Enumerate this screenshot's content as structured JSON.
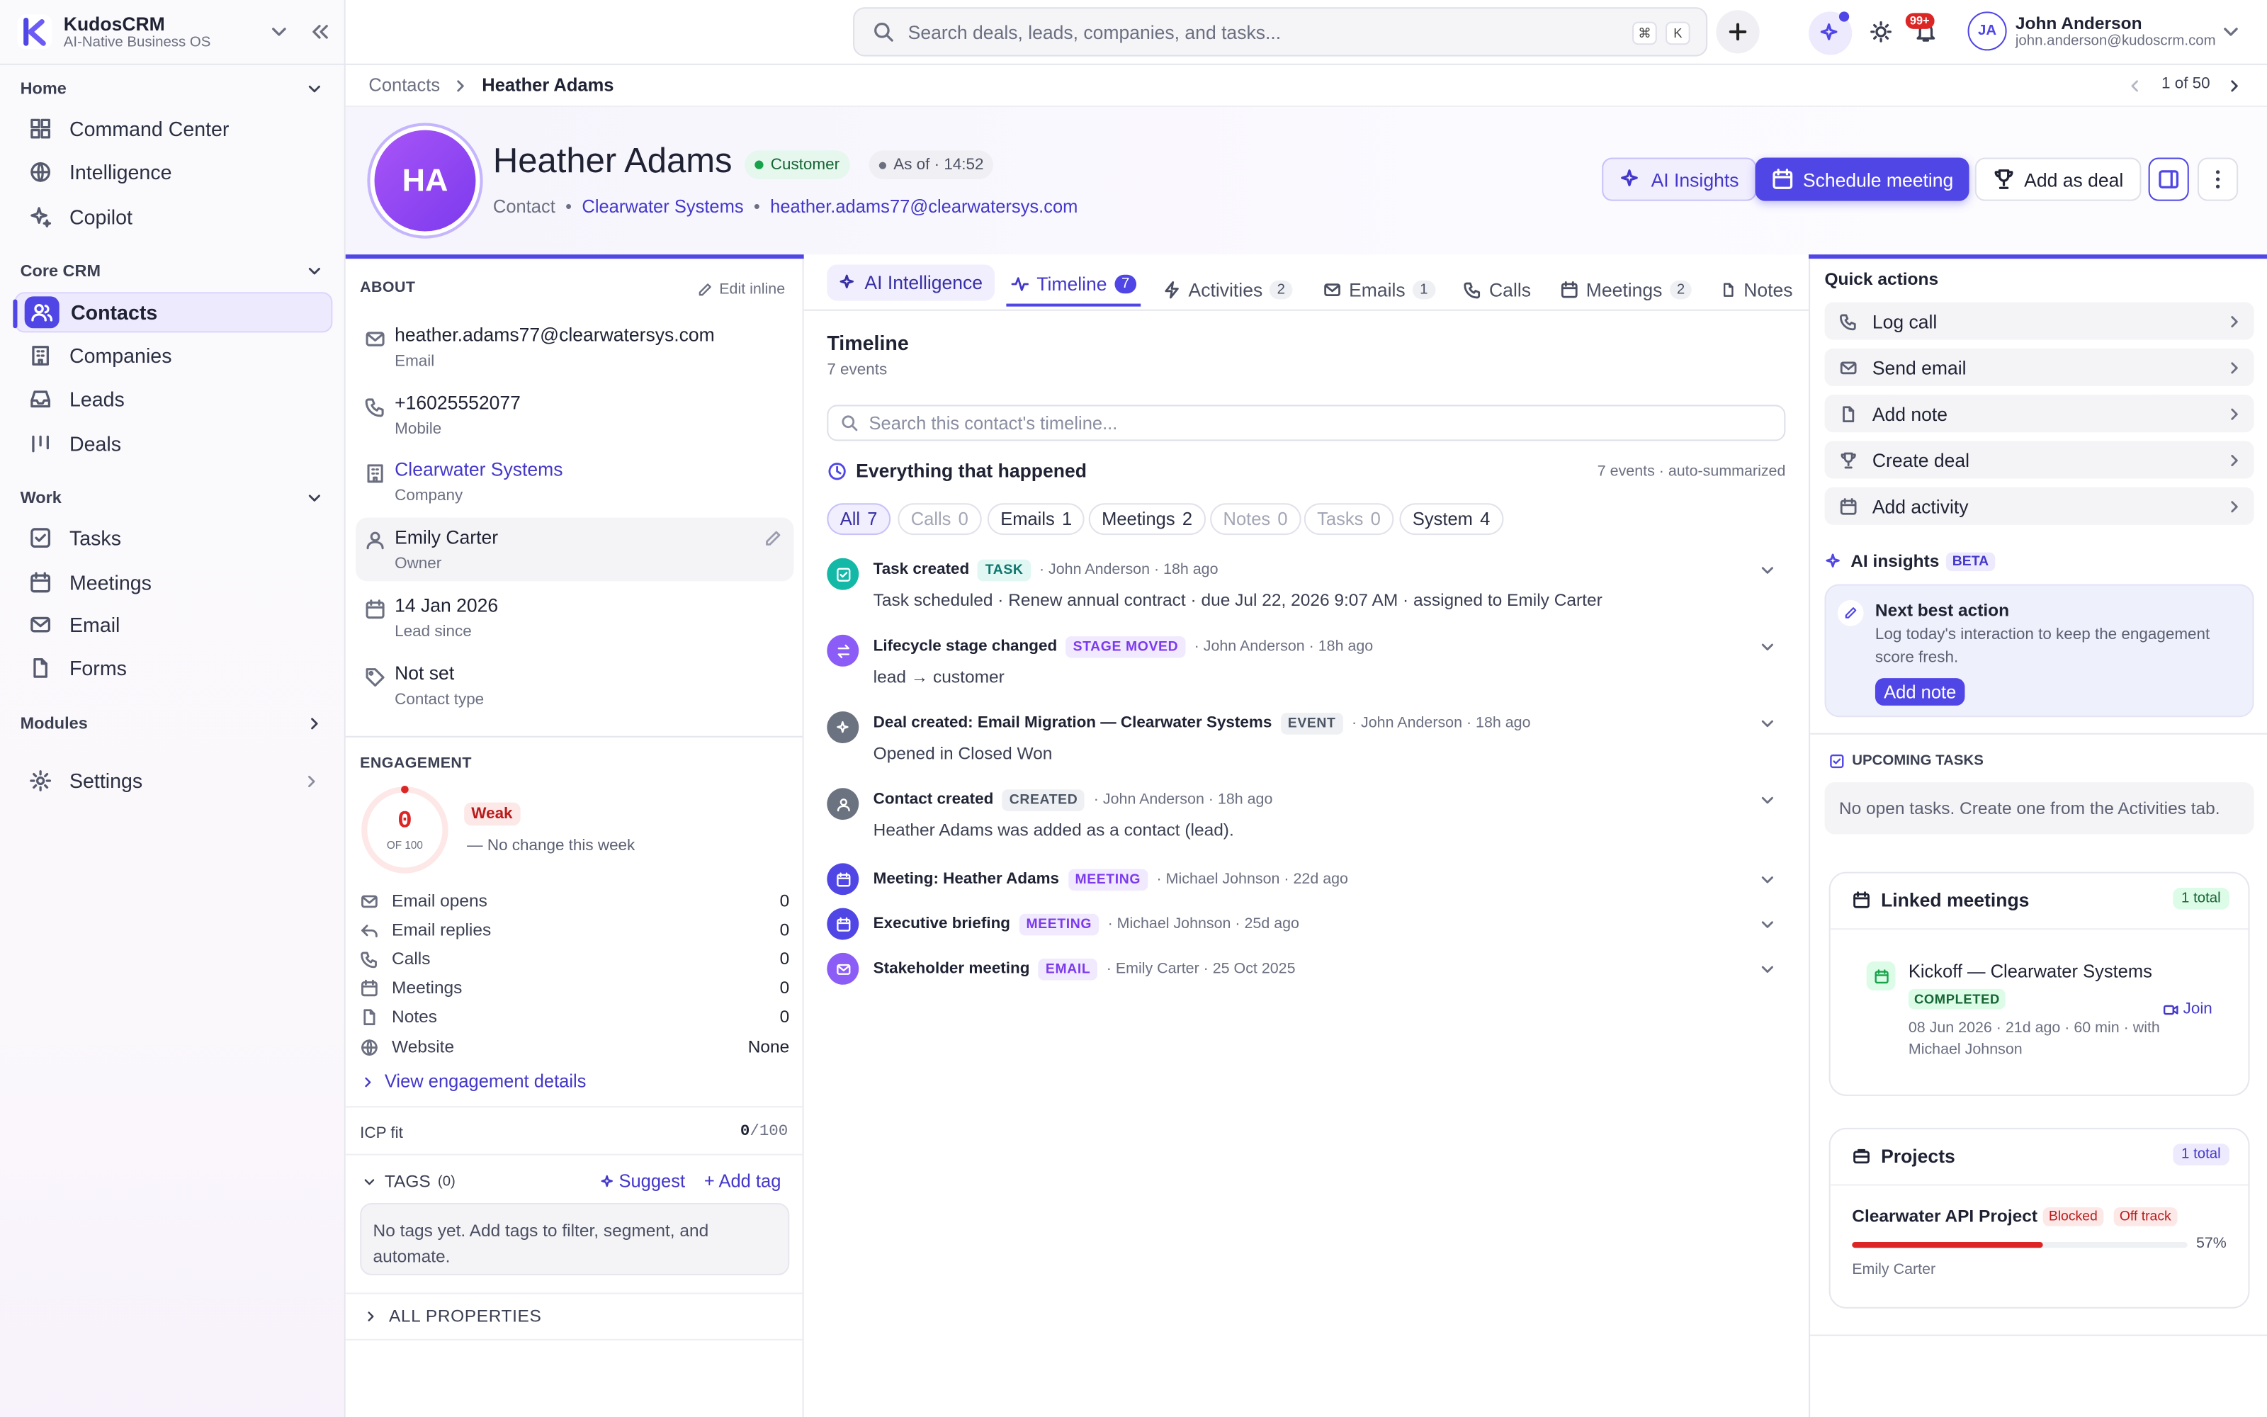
{
  "app": {
    "name": "KudosCRM",
    "tagline": "AI-Native Business OS"
  },
  "sidebar": {
    "sections": [
      {
        "label": "Home",
        "items": [
          {
            "label": "Command Center",
            "icon": "grid-icon"
          },
          {
            "label": "Intelligence",
            "icon": "globe-icon"
          },
          {
            "label": "Copilot",
            "icon": "sparkle-icon"
          }
        ]
      },
      {
        "label": "Core CRM",
        "items": [
          {
            "label": "Contacts",
            "icon": "users-icon"
          },
          {
            "label": "Companies",
            "icon": "building-icon"
          },
          {
            "label": "Leads",
            "icon": "inbox-icon"
          },
          {
            "label": "Deals",
            "icon": "bars-icon"
          }
        ]
      },
      {
        "label": "Work",
        "items": [
          {
            "label": "Tasks",
            "icon": "check-square-icon"
          },
          {
            "label": "Meetings",
            "icon": "calendar-icon"
          },
          {
            "label": "Email",
            "icon": "mail-icon"
          },
          {
            "label": "Forms",
            "icon": "file-icon"
          }
        ]
      }
    ],
    "modules": "Modules",
    "settings": "Settings"
  },
  "topbar": {
    "search_placeholder": "Search deals, leads, companies, and tasks...",
    "kbd1": "⌘",
    "kbd2": "K",
    "notif_count": "99+",
    "user_initials": "JA",
    "user_name": "John Anderson",
    "user_email": "john.anderson@kudoscrm.com"
  },
  "breadcrumb": {
    "parent": "Contacts",
    "current": "Heather Adams",
    "pager": "1 of 50"
  },
  "contact": {
    "initials": "HA",
    "name": "Heather Adams",
    "status": "Customer",
    "as_of": "As of · 14:52",
    "type": "Contact",
    "company": "Clearwater Systems",
    "email": "heather.adams77@clearwatersys.com"
  },
  "actions": {
    "ai_insights": "AI Insights",
    "schedule": "Schedule meeting",
    "add_deal": "Add as deal"
  },
  "about": {
    "title": "ABOUT",
    "edit": "Edit inline",
    "fields": [
      {
        "value": "heather.adams77@clearwatersys.com",
        "label": "Email"
      },
      {
        "value": "+16025552077",
        "label": "Mobile"
      },
      {
        "value": "Clearwater Systems",
        "label": "Company"
      },
      {
        "value": "Emily Carter",
        "label": "Owner"
      },
      {
        "value": "14 Jan 2026",
        "label": "Lead since"
      },
      {
        "value": "Not set",
        "label": "Contact type"
      }
    ]
  },
  "engagement": {
    "title": "ENGAGEMENT",
    "score": "0",
    "of": "OF 100",
    "level": "Weak",
    "change": "— No change this week",
    "rows": [
      {
        "label": "Email opens",
        "value": "0"
      },
      {
        "label": "Email replies",
        "value": "0"
      },
      {
        "label": "Calls",
        "value": "0"
      },
      {
        "label": "Meetings",
        "value": "0"
      },
      {
        "label": "Notes",
        "value": "0"
      },
      {
        "label": "Website",
        "value": "None"
      }
    ],
    "details_link": "View engagement details",
    "icp_label": "ICP fit",
    "icp_value": "0",
    "icp_max": "/100"
  },
  "tags": {
    "title": "TAGS",
    "count": "(0)",
    "suggest": "Suggest",
    "add": "+ Add tag",
    "empty": "No tags yet. Add tags to filter, segment, and automate."
  },
  "all_properties": "ALL PROPERTIES",
  "tabs": [
    {
      "label": "AI Intelligence",
      "count": ""
    },
    {
      "label": "Timeline",
      "count": "7"
    },
    {
      "label": "Activities",
      "count": "2"
    },
    {
      "label": "Emails",
      "count": "1"
    },
    {
      "label": "Calls",
      "count": ""
    },
    {
      "label": "Meetings",
      "count": "2"
    },
    {
      "label": "Notes",
      "count": ""
    }
  ],
  "timeline": {
    "title": "Timeline",
    "subtitle": "7 events",
    "search_placeholder": "Search this contact's timeline...",
    "summary_title": "Everything that happened",
    "summary_meta": "7 events · auto-summarized",
    "filters": [
      {
        "label": "All",
        "count": "7"
      },
      {
        "label": "Calls",
        "count": "0"
      },
      {
        "label": "Emails",
        "count": "1"
      },
      {
        "label": "Meetings",
        "count": "2"
      },
      {
        "label": "Notes",
        "count": "0"
      },
      {
        "label": "Tasks",
        "count": "0"
      },
      {
        "label": "System",
        "count": "4"
      }
    ],
    "events": [
      {
        "title": "Task created",
        "tag": "TASK",
        "meta": "· John Anderson · 18h ago",
        "desc": "Task scheduled · Renew annual contract · due Jul 22, 2026 9:07 AM · assigned to Emily Carter"
      },
      {
        "title": "Lifecycle stage changed",
        "tag": "STAGE MOVED",
        "meta": "· John Anderson · 18h ago",
        "desc": "lead → customer"
      },
      {
        "title": "Deal created: Email Migration — Clearwater Systems",
        "tag": "EVENT",
        "meta": "· John Anderson · 18h ago",
        "desc": "Opened in Closed Won"
      },
      {
        "title": "Contact created",
        "tag": "CREATED",
        "meta": "· John Anderson · 18h ago",
        "desc": "Heather Adams was added as a contact (lead)."
      },
      {
        "title": "Meeting: Heather Adams",
        "tag": "MEETING",
        "meta": "· Michael Johnson · 22d ago",
        "desc": ""
      },
      {
        "title": "Executive briefing",
        "tag": "MEETING",
        "meta": "· Michael Johnson · 25d ago",
        "desc": ""
      },
      {
        "title": "Stakeholder meeting",
        "tag": "EMAIL",
        "meta": "· Emily Carter · 25 Oct 2025",
        "desc": ""
      }
    ]
  },
  "quick_actions": {
    "title": "Quick actions",
    "items": [
      {
        "label": "Log call"
      },
      {
        "label": "Send email"
      },
      {
        "label": "Add note"
      },
      {
        "label": "Create deal"
      },
      {
        "label": "Add activity"
      }
    ]
  },
  "ai_insights": {
    "title": "AI insights",
    "beta": "BETA",
    "nba_title": "Next best action",
    "nba_text": "Log today's interaction to keep the engagement score fresh.",
    "nba_button": "Add note"
  },
  "upcoming": {
    "title": "UPCOMING TASKS",
    "empty": "No open tasks. Create one from the Activities tab."
  },
  "linked_meetings": {
    "title": "Linked meetings",
    "total": "1 total",
    "meeting_title": "Kickoff — Clearwater Systems",
    "status": "COMPLETED",
    "details": "08 Jun 2026 · 21d ago · 60 min · with",
    "with": "Michael Johnson",
    "join": "Join"
  },
  "projects": {
    "title": "Projects",
    "total": "1 total",
    "name": "Clearwater API Project",
    "badge1": "Blocked",
    "badge2": "Off track",
    "progress": 0.57,
    "progress_label": "57%",
    "owner": "Emily Carter"
  },
  "colors": {
    "accent": "#4f46e5",
    "link": "#4338ca",
    "danger": "#dc2626",
    "success": "#16a34a"
  }
}
